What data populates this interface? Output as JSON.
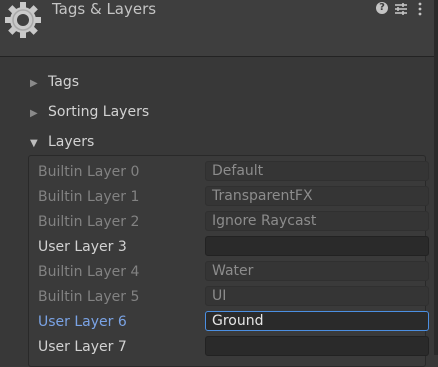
{
  "window": {
    "title": "Tags & Layers",
    "icons": {
      "settings": "gear-icon",
      "help": "help-icon",
      "presets": "tune-icon",
      "more": "more-icon"
    },
    "help_glyph": "?"
  },
  "foldouts": [
    {
      "label": "Tags",
      "expanded": false
    },
    {
      "label": "Sorting Layers",
      "expanded": false
    },
    {
      "label": "Layers",
      "expanded": true
    }
  ],
  "layers": [
    {
      "label": "Builtin Layer 0",
      "value": "Default",
      "builtin": true
    },
    {
      "label": "Builtin Layer 1",
      "value": "TransparentFX",
      "builtin": true
    },
    {
      "label": "Builtin Layer 2",
      "value": "Ignore Raycast",
      "builtin": true
    },
    {
      "label": "User Layer 3",
      "value": "",
      "builtin": false
    },
    {
      "label": "Builtin Layer 4",
      "value": "Water",
      "builtin": true
    },
    {
      "label": "Builtin Layer 5",
      "value": "UI",
      "builtin": true
    },
    {
      "label": "User Layer 6",
      "value": "Ground",
      "builtin": false,
      "focused": true
    },
    {
      "label": "User Layer 7",
      "value": "",
      "builtin": false
    }
  ],
  "colors": {
    "focus_accent": "#4b8fe2",
    "selected_label": "#7aa3e5"
  }
}
